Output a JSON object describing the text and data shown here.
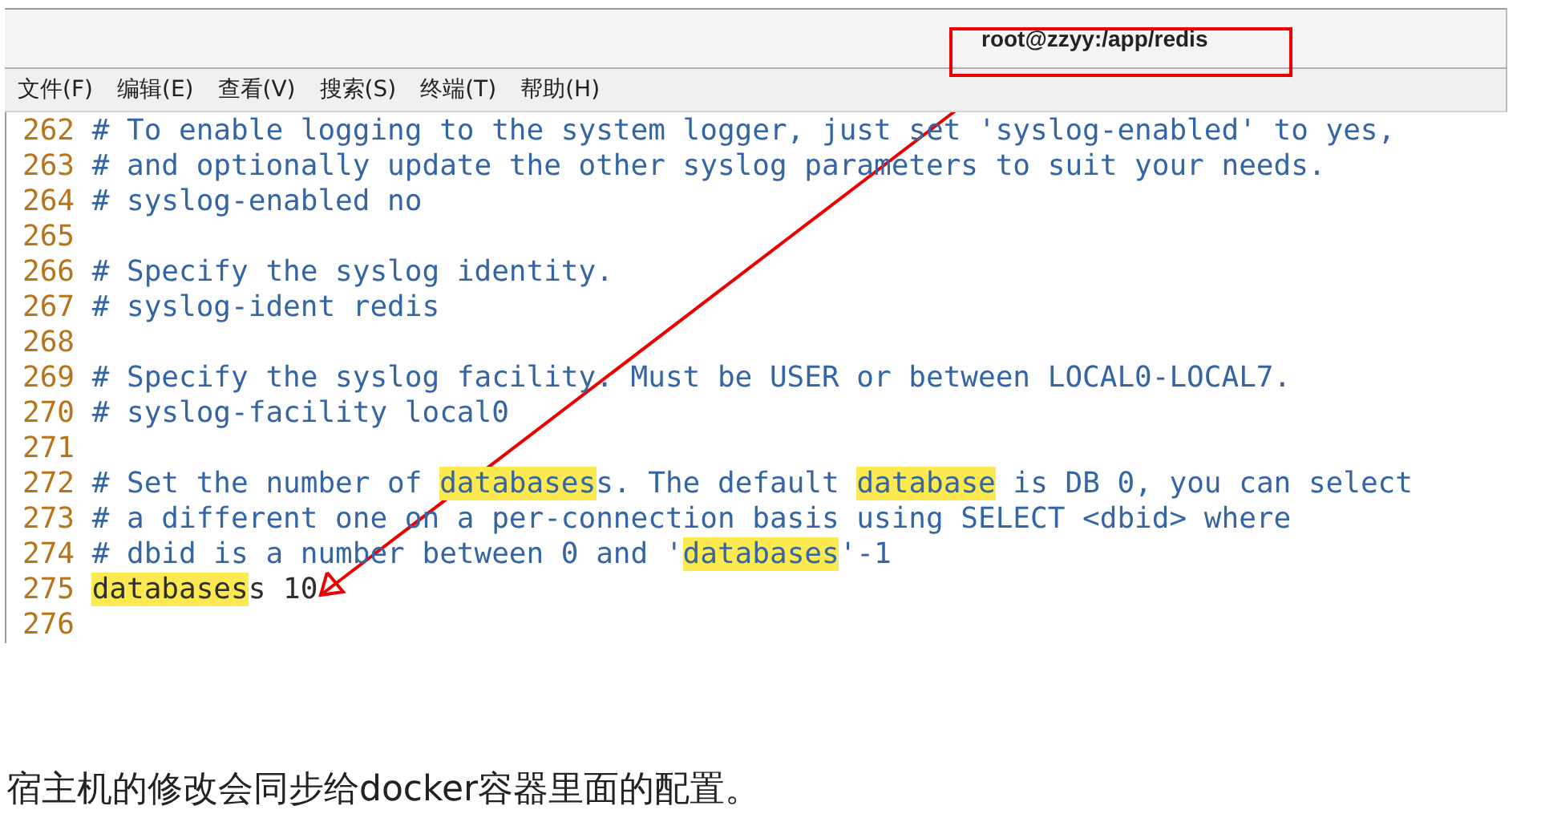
{
  "window": {
    "title": "root@zzyy:/app/redis"
  },
  "menu": [
    "文件(F)",
    "编辑(E)",
    "查看(V)",
    "搜索(S)",
    "终端(T)",
    "帮助(H)"
  ],
  "lines": [
    {
      "number": "262",
      "kind": "comment",
      "segments": [
        {
          "text": "# To enable logging to the system logger, just set 'syslog-enabled' to yes,",
          "highlighted": false
        }
      ]
    },
    {
      "number": "263",
      "kind": "comment",
      "segments": [
        {
          "text": "# and optionally update the other syslog parameters to suit your needs.",
          "highlighted": false
        }
      ]
    },
    {
      "number": "264",
      "kind": "comment",
      "segments": [
        {
          "text": "# syslog-enabled no",
          "highlighted": false
        }
      ]
    },
    {
      "number": "265",
      "kind": "blank"
    },
    {
      "number": "266",
      "kind": "comment",
      "segments": [
        {
          "text": "# Specify the syslog identity.",
          "highlighted": false
        }
      ]
    },
    {
      "number": "267",
      "kind": "comment",
      "segments": [
        {
          "text": "# syslog-ident redis",
          "highlighted": false
        }
      ]
    },
    {
      "number": "268",
      "kind": "blank"
    },
    {
      "number": "269",
      "kind": "comment",
      "segments": [
        {
          "text": "# Specify the syslog facility. Must be USER or between LOCAL0-LOCAL7.",
          "highlighted": false
        }
      ]
    },
    {
      "number": "270",
      "kind": "comment",
      "segments": [
        {
          "text": "# syslog-facility local0",
          "highlighted": false
        }
      ]
    },
    {
      "number": "271",
      "kind": "blank"
    },
    {
      "number": "272",
      "kind": "comment",
      "segments": [
        {
          "text": "# Set the number of ",
          "highlighted": false
        },
        {
          "text": "databases",
          "highlighted": true
        },
        {
          "text": "s. The default ",
          "highlighted": false
        },
        {
          "text": "database",
          "highlighted": true
        },
        {
          "text": " is DB 0, you can select",
          "highlighted": false
        }
      ]
    },
    {
      "number": "273",
      "kind": "comment",
      "segments": [
        {
          "text": "# a different one on a per-connection basis using SELECT <dbid> where",
          "highlighted": false
        }
      ]
    },
    {
      "number": "274",
      "kind": "comment",
      "segments": [
        {
          "text": "# dbid is a number between 0 and '",
          "highlighted": false
        },
        {
          "text": "databases",
          "highlighted": true
        },
        {
          "text": "'-1",
          "highlighted": false
        }
      ]
    },
    {
      "number": "275",
      "kind": "code",
      "segments": [
        {
          "text": "databases",
          "highlighted": true
        },
        {
          "text": "s 10",
          "highlighted": false
        }
      ]
    },
    {
      "number": "276",
      "kind": "blank"
    }
  ],
  "caption": "宿主机的修改会同步给docker容器里面的配置。"
}
